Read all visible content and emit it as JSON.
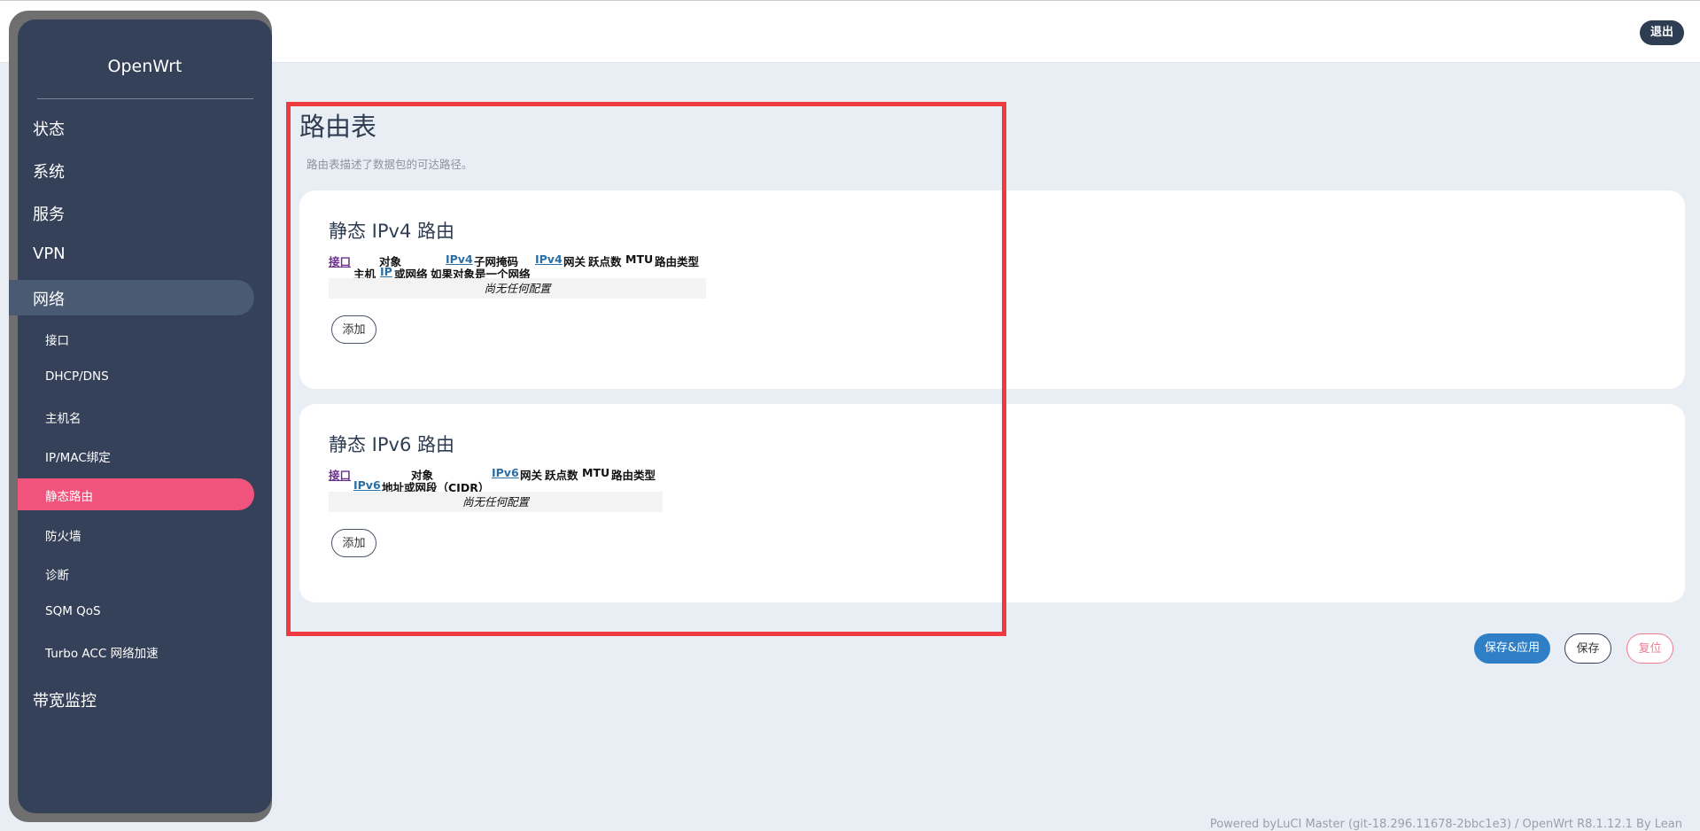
{
  "header": {
    "logout_label": "退出"
  },
  "sidebar": {
    "brand": "OpenWrt",
    "top_items": [
      {
        "label": "状态"
      },
      {
        "label": "系统"
      },
      {
        "label": "服务"
      },
      {
        "label": "VPN"
      },
      {
        "label": "网络"
      },
      {
        "label": "带宽监控"
      }
    ],
    "sub_items": [
      {
        "label": "接口"
      },
      {
        "label": "DHCP/DNS"
      },
      {
        "label": "主机名"
      },
      {
        "label": "IP/MAC绑定"
      },
      {
        "label": "静态路由"
      },
      {
        "label": "防火墙"
      },
      {
        "label": "诊断"
      },
      {
        "label": "SQM QoS"
      },
      {
        "label": "Turbo ACC 网络加速"
      }
    ]
  },
  "page": {
    "title": "路由表",
    "description": "路由表描述了数据包的可达路径。"
  },
  "ipv4": {
    "title": "静态 IPv4 路由",
    "headers": {
      "interface": "接口",
      "target_1": "对象",
      "target_2a": "主机",
      "target_2b": "IP",
      "target_2c": "或网络",
      "mask_1a": "IPv4",
      "mask_1b": "子网掩码",
      "mask_2": "如果对象是一个网络",
      "gw_a": "IPv4",
      "gw_b": "网关",
      "metric": "跃点数",
      "mtu": "MTU",
      "type": "路由类型"
    },
    "empty": "尚无任何配置",
    "add_label": "添加"
  },
  "ipv6": {
    "title": "静态 IPv6 路由",
    "headers": {
      "interface": "接口",
      "target_1": "对象",
      "target_2a": "IPv6",
      "target_2b": "地址或网段（CIDR）",
      "gw_a": "IPv6",
      "gw_b": "网关",
      "metric": "跃点数",
      "mtu": "MTU",
      "type": "路由类型"
    },
    "empty": "尚无任何配置",
    "add_label": "添加"
  },
  "actions": {
    "save_apply": "保存&应用",
    "save": "保存",
    "reset": "复位"
  },
  "footer": "Powered byLuCI Master (git-18.296.11678-2bbc1e3) / OpenWrt R8.1.12.1 By Lean",
  "colors": {
    "sidebar_bg": "#354158",
    "active_item": "#f0537c",
    "highlight_frame": "#ef3b3f",
    "primary_button": "#2f7fc6"
  }
}
